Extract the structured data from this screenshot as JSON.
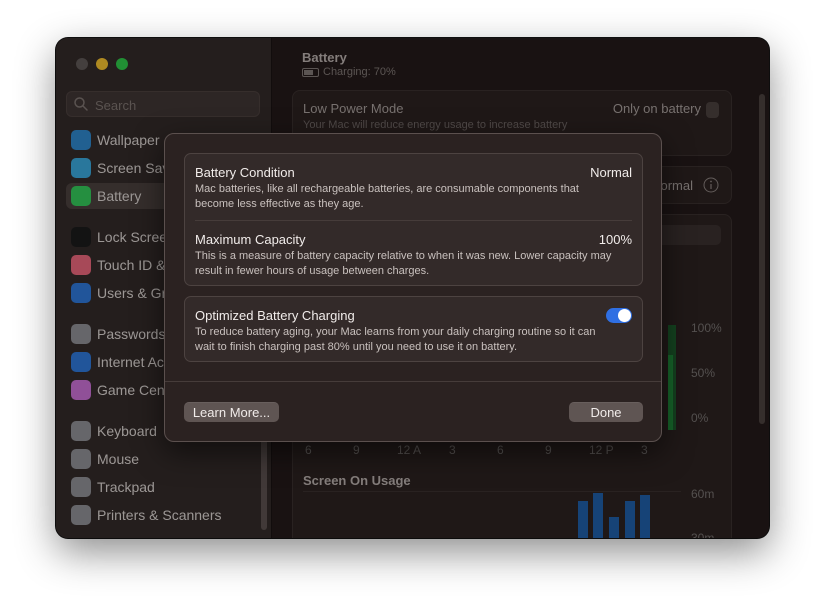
{
  "sidebar": {
    "search_placeholder": "Search",
    "items": [
      {
        "label": "Wallpaper",
        "icon": "wallpaper-icon",
        "color": "#2f86c9"
      },
      {
        "label": "Screen Saver",
        "icon": "screen-saver-icon",
        "color": "#3aa5d8"
      },
      {
        "label": "Battery",
        "icon": "battery-icon",
        "color": "#34c759"
      },
      {
        "label": "Lock Screen",
        "icon": "lock-icon",
        "color": "#1b1b1b"
      },
      {
        "label": "Touch ID & Password",
        "icon": "fingerprint-icon",
        "color": "#e8667a"
      },
      {
        "label": "Users & Groups",
        "icon": "users-icon",
        "color": "#2e77d6"
      },
      {
        "label": "Passwords",
        "icon": "key-icon",
        "color": "#8e8e93"
      },
      {
        "label": "Internet Accounts",
        "icon": "at-icon",
        "color": "#2e77d6"
      },
      {
        "label": "Game Center",
        "icon": "game-center-icon",
        "color": "#c86fd3"
      },
      {
        "label": "Keyboard",
        "icon": "keyboard-icon",
        "color": "#8e8e93"
      },
      {
        "label": "Mouse",
        "icon": "mouse-icon",
        "color": "#8e8e93"
      },
      {
        "label": "Trackpad",
        "icon": "trackpad-icon",
        "color": "#8e8e93"
      },
      {
        "label": "Printers & Scanners",
        "icon": "printer-icon",
        "color": "#8e8e93"
      }
    ]
  },
  "content": {
    "title": "Battery",
    "subtitle": "Charging: 70%",
    "low_power": {
      "title": "Low Power Mode",
      "value": "Only on battery",
      "desc": "Your Mac will reduce energy usage to increase battery"
    },
    "battery_health_value": "Normal",
    "chart_percent_ticks": [
      "100%",
      "50%",
      "0%"
    ],
    "chart_time_ticks": [
      "6",
      "9",
      "12 A",
      "3",
      "6",
      "9",
      "12 P",
      "3"
    ],
    "screen_on_usage": {
      "title": "Screen On Usage",
      "ticks": [
        "60m",
        "30m"
      ]
    }
  },
  "dialog": {
    "condition": {
      "title": "Battery Condition",
      "value": "Normal",
      "desc": "Mac batteries, like all rechargeable batteries, are consumable components that become less effective as they age."
    },
    "capacity": {
      "title": "Maximum Capacity",
      "value": "100%",
      "desc": "This is a measure of battery capacity relative to when it was new. Lower capacity may result in fewer hours of usage between charges."
    },
    "optimized": {
      "title": "Optimized Battery Charging",
      "desc": "To reduce battery aging, your Mac learns from your daily charging routine so it can wait to finish charging past 80% until you need to use it on battery.",
      "enabled": true
    },
    "learn_more": "Learn More...",
    "done": "Done"
  },
  "colors": {
    "accent": "#2f6fe3",
    "battery_green": "#34c759",
    "usage_blue": "#1f5ea6"
  }
}
